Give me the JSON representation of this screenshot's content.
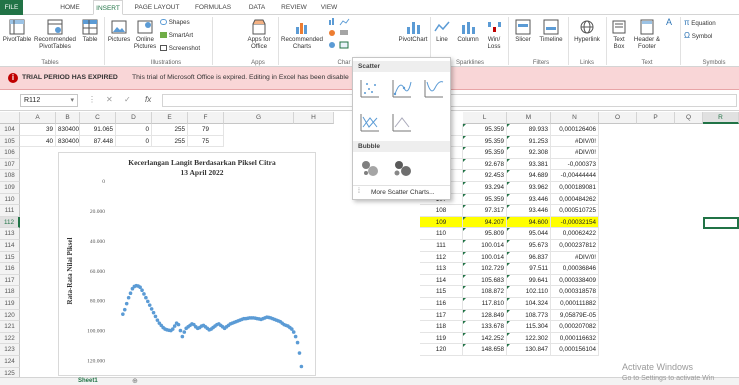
{
  "tabs": {
    "file": "FILE",
    "home": "HOME",
    "insert": "INSERT",
    "page_layout": "PAGE LAYOUT",
    "formulas": "FORMULAS",
    "data": "DATA",
    "review": "REVIEW",
    "view": "VIEW"
  },
  "ribbon": {
    "pivottable": "PivotTable",
    "recommended_pivot": "Recommended PivotTables",
    "table": "Table",
    "pictures": "Pictures",
    "online_pictures": "Online Pictures",
    "shapes": "Shapes",
    "smartart": "SmartArt",
    "screenshot": "Screenshot",
    "apps_for_office": "Apps for Office",
    "recommended_charts": "Recommended Charts",
    "pivotchart": "PivotChart",
    "line": "Line",
    "column": "Column",
    "winloss": "Win/ Loss",
    "slicer": "Slicer",
    "timeline": "Timeline",
    "hyperlink": "Hyperlink",
    "text_box": "Text Box",
    "header_footer": "Header & Footer",
    "equation": "Equation",
    "symbol": "Symbol",
    "groups": {
      "tables": "Tables",
      "illustrations": "Illustrations",
      "apps": "Apps",
      "charts": "Char",
      "sparklines": "Sparklines",
      "filters": "Filters",
      "links": "Links",
      "text": "Text",
      "symbols": "Symbols"
    }
  },
  "message": {
    "title": "TRIAL PERIOD HAS EXPIRED",
    "body": "This trial of Microsoft Office is expired. Editing in Excel has been disable"
  },
  "formula": {
    "namebox": "R112",
    "fx": "fx",
    "value": ""
  },
  "columns": {
    "left": [
      "A",
      "B",
      "C",
      "D",
      "E",
      "F",
      "G",
      "H"
    ],
    "right": [
      "L",
      "M",
      "N",
      "O",
      "P",
      "Q",
      "R"
    ]
  },
  "rows": [
    "104",
    "105",
    "106",
    "107",
    "108",
    "109",
    "110",
    "111",
    "112",
    "113",
    "114",
    "115",
    "116",
    "117",
    "118",
    "119",
    "120",
    "121",
    "122",
    "123",
    "124",
    "125"
  ],
  "left_cells": [
    [
      "39",
      "830400",
      "91.065",
      "0",
      "255",
      "79"
    ],
    [
      "40",
      "830400",
      "87.448",
      "0",
      "255",
      "75"
    ]
  ],
  "right_table": [
    {
      "k": "",
      "l": "95.359",
      "m": "89.933",
      "n": "0,000126406"
    },
    {
      "k": "",
      "l": "95.359",
      "m": "91.253",
      "n": "#DIV/0!"
    },
    {
      "k": "",
      "l": "95.359",
      "m": "92.308",
      "n": "#DIV/0!"
    },
    {
      "k": "",
      "l": "92.678",
      "m": "93.381",
      "n": "-0,000373"
    },
    {
      "k": "",
      "l": "92.453",
      "m": "94.689",
      "n": "-0,00444444"
    },
    {
      "k": "",
      "l": "93.294",
      "m": "93.962",
      "n": "0,000189081"
    },
    {
      "k": "107",
      "l": "95.359",
      "m": "93.446",
      "n": "0,000484262"
    },
    {
      "k": "108",
      "l": "97.317",
      "m": "93.446",
      "n": "0,000510725"
    },
    {
      "k": "109",
      "l": "94.207",
      "m": "94.600",
      "n": "-0,00032154"
    },
    {
      "k": "110",
      "l": "95.809",
      "m": "95.044",
      "n": "0,00062422"
    },
    {
      "k": "111",
      "l": "100.014",
      "m": "95.673",
      "n": "0,000237812"
    },
    {
      "k": "112",
      "l": "100.014",
      "m": "96.837",
      "n": "#DIV/0!"
    },
    {
      "k": "113",
      "l": "102.729",
      "m": "97.511",
      "n": "0,00036846"
    },
    {
      "k": "114",
      "l": "105.683",
      "m": "99.641",
      "n": "0,000338409"
    },
    {
      "k": "115",
      "l": "108.872",
      "m": "102.110",
      "n": "0,000318578"
    },
    {
      "k": "116",
      "l": "117.810",
      "m": "104.324",
      "n": "0,000111882"
    },
    {
      "k": "117",
      "l": "128.849",
      "m": "108.773",
      "n": "9,05879E-05"
    },
    {
      "k": "118",
      "l": "133.678",
      "m": "115.304",
      "n": "0,000207082"
    },
    {
      "k": "119",
      "l": "142.252",
      "m": "122.302",
      "n": "0,000116632"
    },
    {
      "k": "120",
      "l": "148.658",
      "m": "130.847",
      "n": "0,000156104"
    }
  ],
  "dropdown": {
    "scatter": "Scatter",
    "bubble": "Bubble",
    "more": "More Scatter Charts..."
  },
  "sheet": {
    "tab": "Sheet1"
  },
  "watermark": {
    "line1": "Activate Windows",
    "line2": "Go to Settings to activate Win"
  },
  "chart_data": {
    "type": "scatter",
    "title": "Kecerlangan Langit Berdasarkan Piksel Citra",
    "subtitle": "13 April 2022",
    "ylabel": "Rata-Rata Nilai Piksel",
    "yticks": [
      "0",
      "20.000",
      "40.000",
      "60.000",
      "80.000",
      "100.000",
      "120.000"
    ],
    "ylim": [
      0,
      125000
    ],
    "reversed_y": true,
    "xlim": [
      0,
      100
    ],
    "color": "#5b9bd5",
    "series": [
      {
        "x": [
          2,
          3,
          4,
          5,
          6,
          7,
          8,
          9,
          10,
          11,
          12,
          13,
          14,
          15,
          16,
          17,
          18,
          19,
          20,
          21,
          22,
          23,
          24,
          25,
          26,
          27,
          28,
          29,
          30,
          31,
          32,
          33,
          34,
          35,
          36,
          37,
          38,
          39,
          40,
          41,
          42,
          43,
          44,
          45,
          46,
          47,
          48,
          49,
          50,
          51,
          52,
          53,
          54,
          55,
          56,
          57,
          58,
          59,
          60,
          61,
          62,
          63,
          64,
          65,
          66,
          67,
          68,
          69,
          70,
          71,
          72,
          73,
          74,
          75,
          76,
          77,
          78,
          79,
          80,
          81,
          82,
          83,
          84,
          85,
          86,
          87,
          88,
          89,
          90,
          91,
          92,
          93,
          94,
          95
        ],
        "y": [
          89000,
          86000,
          82000,
          78000,
          75000,
          72000,
          70500,
          70000,
          70200,
          71000,
          73000,
          75500,
          78000,
          80500,
          83000,
          85500,
          88000,
          90500,
          93000,
          95000,
          96500,
          98000,
          99000,
          99500,
          99800,
          100000,
          99000,
          97000,
          95000,
          96000,
          100000,
          104000,
          101000,
          98500,
          97500,
          96500,
          95500,
          96000,
          97500,
          98500,
          98000,
          97000,
          96500,
          97500,
          98500,
          99500,
          99000,
          98000,
          97000,
          96000,
          95500,
          96500,
          97500,
          98500,
          97500,
          96500,
          95500,
          95000,
          94500,
          94000,
          93500,
          93000,
          92500,
          92000,
          92000,
          91800,
          91500,
          91500,
          91500,
          91700,
          92000,
          92200,
          92500,
          92000,
          91500,
          91000,
          91200,
          91500,
          92000,
          92500,
          93000,
          93500,
          94000,
          95000,
          96000,
          96500,
          97000,
          98000,
          99000,
          101000,
          104000,
          108000,
          115000,
          124000
        ]
      }
    ]
  }
}
